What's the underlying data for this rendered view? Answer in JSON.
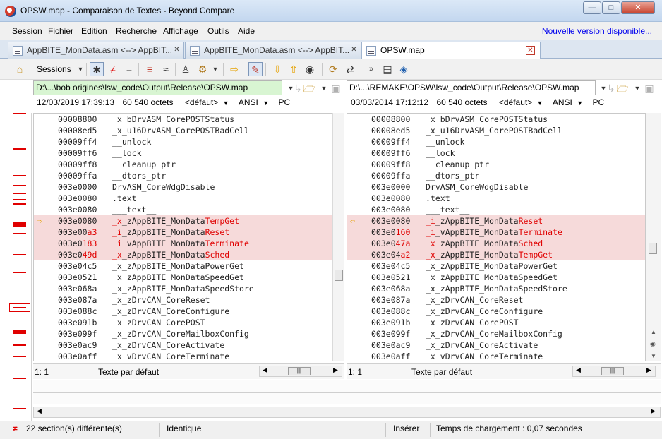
{
  "window": {
    "title": "OPSW.map - Comparaison de Textes - Beyond Compare"
  },
  "menu": {
    "items": [
      "Session",
      "Fichier",
      "Edition",
      "Recherche",
      "Affichage",
      "Outils",
      "Aide"
    ],
    "update_link": "Nouvelle version disponible..."
  },
  "tabs": [
    {
      "label": "AppBITE_MonData.asm <--> AppBIT..."
    },
    {
      "label": "AppBITE_MonData.asm <--> AppBIT..."
    },
    {
      "label": "OPSW.map"
    }
  ],
  "toolbar": {
    "sessions_label": "Sessions"
  },
  "left": {
    "path": "D:\\...\\bob origines\\lsw_code\\Output\\Release\\OPSW.map",
    "date": "12/03/2019 17:39:13",
    "size": "60 540 octets",
    "format": "<défaut>",
    "encoding": "ANSI",
    "eol": "PC",
    "rows": [
      {
        "addr": "00008800",
        "sym": "_x_bDrvASM_CorePOSTStatus"
      },
      {
        "addr": "00008ed5",
        "sym": "_x_u16DrvASM_CorePOSTBadCell"
      },
      {
        "addr": "00009ff4",
        "sym": "__unlock"
      },
      {
        "addr": "00009ff6",
        "sym": "__lock"
      },
      {
        "addr": "00009ff8",
        "sym": "__cleanup_ptr"
      },
      {
        "addr": "00009ffa",
        "sym": "__dtors_ptr"
      },
      {
        "addr": "003e0000",
        "sym": "DrvASM_CoreWdgDisable"
      },
      {
        "addr": "003e0080",
        "sym": ".text"
      },
      {
        "addr": "003e0080",
        "sym": "___text__"
      },
      {
        "addr_a": "003e0080",
        "addr_b": "",
        "sym_a": "_x_zAppBITE_MonData",
        "sym_b": "TempGet"
      },
      {
        "addr_a": "003e00",
        "addr_b": "a3",
        "sym_a": "_i_zAppBITE_MonData",
        "sym_b": "Reset"
      },
      {
        "addr_a": "003e0",
        "addr_b": "183",
        "sym_a": "_i_vAppBITE_MonData",
        "sym_b": "Terminate"
      },
      {
        "addr_a": "003e0",
        "addr_b": "49d",
        "sym_a": "_x_zAppBITE_MonData",
        "sym_b": "Sched"
      },
      {
        "addr": "003e04c5",
        "sym": "_x_zAppBITE_MonDataPowerGet"
      },
      {
        "addr": "003e0521",
        "sym": "_x_zAppBITE_MonDataSpeedGet"
      },
      {
        "addr": "003e068a",
        "sym": "_x_zAppBITE_MonDataSpeedStore"
      },
      {
        "addr": "003e087a",
        "sym": "_x_zDrvCAN_CoreReset"
      },
      {
        "addr": "003e088c",
        "sym": "_x_zDrvCAN_CoreConfigure"
      },
      {
        "addr": "003e091b",
        "sym": "_x_zDrvCAN_CorePOST"
      },
      {
        "addr": "003e099f",
        "sym": "_x_zDrvCAN_CoreMailboxConfig"
      },
      {
        "addr": "003e0ac9",
        "sym": "_x_zDrvCAN_CoreActivate"
      },
      {
        "addr": "003e0aff",
        "sym": "_x_vDrvCAN_CoreTerminate"
      }
    ],
    "cursor": "1: 1",
    "format_label": "Texte par défaut"
  },
  "right": {
    "path": "D:\\...\\REMAKE\\OPSW\\lsw_code\\Output\\Release\\OPSW.map",
    "date": "03/03/2014 17:12:12",
    "size": "60 540 octets",
    "format": "<défaut>",
    "encoding": "ANSI",
    "eol": "PC",
    "rows": [
      {
        "addr": "00008800",
        "sym": "_x_bDrvASM_CorePOSTStatus"
      },
      {
        "addr": "00008ed5",
        "sym": "_x_u16DrvASM_CorePOSTBadCell"
      },
      {
        "addr": "00009ff4",
        "sym": "__unlock"
      },
      {
        "addr": "00009ff6",
        "sym": "__lock"
      },
      {
        "addr": "00009ff8",
        "sym": "__cleanup_ptr"
      },
      {
        "addr": "00009ffa",
        "sym": "__dtors_ptr"
      },
      {
        "addr": "003e0000",
        "sym": "DrvASM_CoreWdgDisable"
      },
      {
        "addr": "003e0080",
        "sym": ".text"
      },
      {
        "addr": "003e0080",
        "sym": "___text__"
      },
      {
        "addr_a": "003e0080",
        "addr_b": "",
        "sym_a": "_i_zAppBITE_MonData",
        "sym_b": "Reset"
      },
      {
        "addr_a": "003e0",
        "addr_b": "160",
        "sym_a": "_i_vAppBITE_MonData",
        "sym_b": "Terminate"
      },
      {
        "addr_a": "003e0",
        "addr_b": "47a",
        "sym_a": "_x_zAppBITE_MonData",
        "sym_b": "Sched"
      },
      {
        "addr_a": "003e04",
        "addr_b": "a2",
        "sym_a": "_x_zAppBITE_MonData",
        "sym_b": "TempGet"
      },
      {
        "addr": "003e04c5",
        "sym": "_x_zAppBITE_MonDataPowerGet"
      },
      {
        "addr": "003e0521",
        "sym": "_x_zAppBITE_MonDataSpeedGet"
      },
      {
        "addr": "003e068a",
        "sym": "_x_zAppBITE_MonDataSpeedStore"
      },
      {
        "addr": "003e087a",
        "sym": "_x_zDrvCAN_CoreReset"
      },
      {
        "addr": "003e088c",
        "sym": "_x_zDrvCAN_CoreConfigure"
      },
      {
        "addr": "003e091b",
        "sym": "_x_zDrvCAN_CorePOST"
      },
      {
        "addr": "003e099f",
        "sym": "_x_zDrvCAN_CoreMailboxConfig"
      },
      {
        "addr": "003e0ac9",
        "sym": "_x_zDrvCAN_CoreActivate"
      },
      {
        "addr": "003e0aff",
        "sym": "_x_vDrvCAN_CoreTerminate"
      }
    ],
    "cursor": "1: 1",
    "format_label": "Texte par défaut"
  },
  "merge_lines": [
    "**************************************************************************************************",
    "**************************************************************************************************"
  ],
  "status": {
    "diff_count": "22 section(s) différente(s)",
    "state": "Identique",
    "mode": "Insérer",
    "load_time": "Temps de chargement : 0,07 secondes"
  },
  "colors": {
    "diff_bg": "#f6dada",
    "diff_text": "#e00000",
    "link": "#0000ee"
  }
}
